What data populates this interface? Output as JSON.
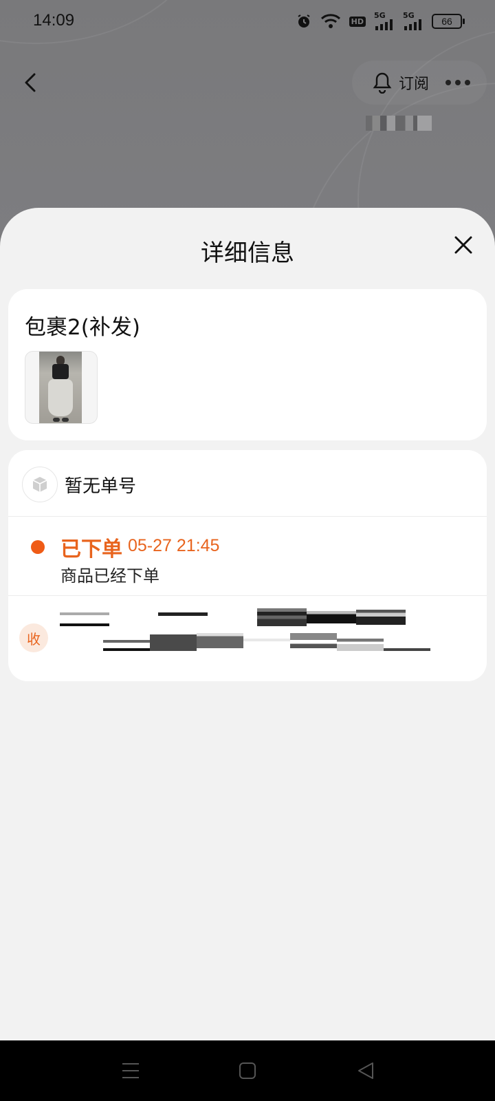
{
  "status_bar": {
    "time": "14:09",
    "hd": "HD",
    "net1": "5G",
    "net2": "5G",
    "battery": "66"
  },
  "header": {
    "subscribe_label": "订阅"
  },
  "sheet": {
    "title": "详细信息",
    "package": {
      "title": "包裹2(补发)"
    },
    "tracking": {
      "number_text": "暂无单号",
      "latest_status": "已下单",
      "latest_time": "05-27 21:45",
      "latest_desc": "商品已经下单",
      "recipient_badge": "收"
    }
  },
  "colors": {
    "accent": "#E8641E",
    "sheet_bg": "#F2F2F2",
    "overlay": "#7B7B7D"
  },
  "icons": [
    "back-icon",
    "bell-icon",
    "more-icon",
    "close-icon",
    "package-box-icon",
    "menu-icon",
    "home-icon",
    "back-nav-icon"
  ]
}
